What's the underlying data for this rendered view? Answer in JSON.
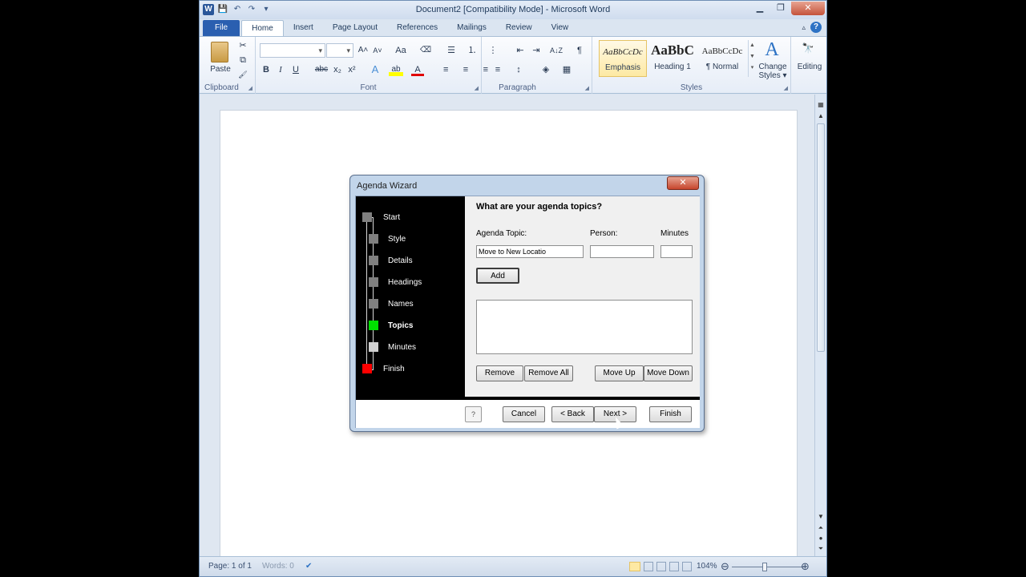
{
  "window": {
    "title": "Document2 [Compatibility Mode] - Microsoft Word",
    "minimize": "▁",
    "restore": "❐",
    "close": "✕"
  },
  "quick_access": {
    "app_icon": "W",
    "save": "💾",
    "undo": "↶",
    "redo": "↷",
    "customize": "▾"
  },
  "tabs": [
    {
      "label": "File"
    },
    {
      "label": "Home"
    },
    {
      "label": "Insert"
    },
    {
      "label": "Page Layout"
    },
    {
      "label": "References"
    },
    {
      "label": "Mailings"
    },
    {
      "label": "Review"
    },
    {
      "label": "View"
    }
  ],
  "tab_right": {
    "minimize_ribbon": "▵",
    "help": "?"
  },
  "ribbon": {
    "clipboard": {
      "label": "Clipboard",
      "paste": "Paste",
      "cut": "✂",
      "copy": "⧉",
      "format_painter": "🖌"
    },
    "font": {
      "label": "Font",
      "grow": "A˄",
      "shrink": "A˅",
      "change_case": "Aa",
      "clear": "⌫",
      "bold": "B",
      "italic": "I",
      "underline": "U",
      "strike": "abc",
      "subscript": "x₂",
      "superscript": "x²",
      "effects": "A",
      "highlight": "ab",
      "color": "A"
    },
    "paragraph": {
      "label": "Paragraph",
      "bullets": "☰",
      "numbering": "⒈",
      "multilevel": "⋮",
      "outdent": "⇤",
      "indent": "⇥",
      "sort": "A↓Z",
      "pilcrow": "¶",
      "align_left": "≡",
      "center": "≡",
      "align_right": "≡",
      "justify": "≡",
      "line_spacing": "↕",
      "shading": "◈",
      "borders": "▦"
    },
    "styles": {
      "label": "Styles",
      "items": [
        {
          "sample": "AaBbCcDc",
          "name": "Emphasis"
        },
        {
          "sample": "AaBbC",
          "name": "Heading 1"
        },
        {
          "sample": "AaBbCcDc",
          "name": "¶ Normal"
        }
      ],
      "change_styles": "Change Styles ▾",
      "change_styles_glyph": "A"
    },
    "editing": {
      "label": "Editing",
      "glyph": "🔭"
    }
  },
  "dialog": {
    "title": "Agenda Wizard",
    "close": "✕",
    "steps": [
      {
        "label": "Start",
        "color": "#808080"
      },
      {
        "label": "Style",
        "color": "#808080"
      },
      {
        "label": "Details",
        "color": "#808080"
      },
      {
        "label": "Headings",
        "color": "#808080"
      },
      {
        "label": "Names",
        "color": "#808080"
      },
      {
        "label": "Topics",
        "color": "#00e000"
      },
      {
        "label": "Minutes",
        "color": "#d0d0d0"
      },
      {
        "label": "Finish",
        "color": "#ff0000"
      }
    ],
    "heading": "What are your agenda topics?",
    "topic_label": "Agenda Topic:",
    "person_label": "Person:",
    "minutes_label": "Minutes",
    "topic_value": "Move to New Locatio",
    "person_value": "",
    "minutes_value": "",
    "add": "Add",
    "remove": "Remove",
    "remove_all": "Remove All",
    "move_up": "Move Up",
    "move_down": "Move Down",
    "help": "?",
    "cancel": "Cancel",
    "back": "< Back",
    "next": "Next >",
    "finish": "Finish"
  },
  "status": {
    "page": "Page: 1 of 1",
    "words": "Words: 0",
    "proofing": "✔",
    "zoom": "104%",
    "zoom_out": "⊖",
    "zoom_in": "⊕"
  },
  "scroll": {
    "up": "▲",
    "down": "▼",
    "prev": "⏶",
    "browse": "●",
    "next": "⏷"
  }
}
